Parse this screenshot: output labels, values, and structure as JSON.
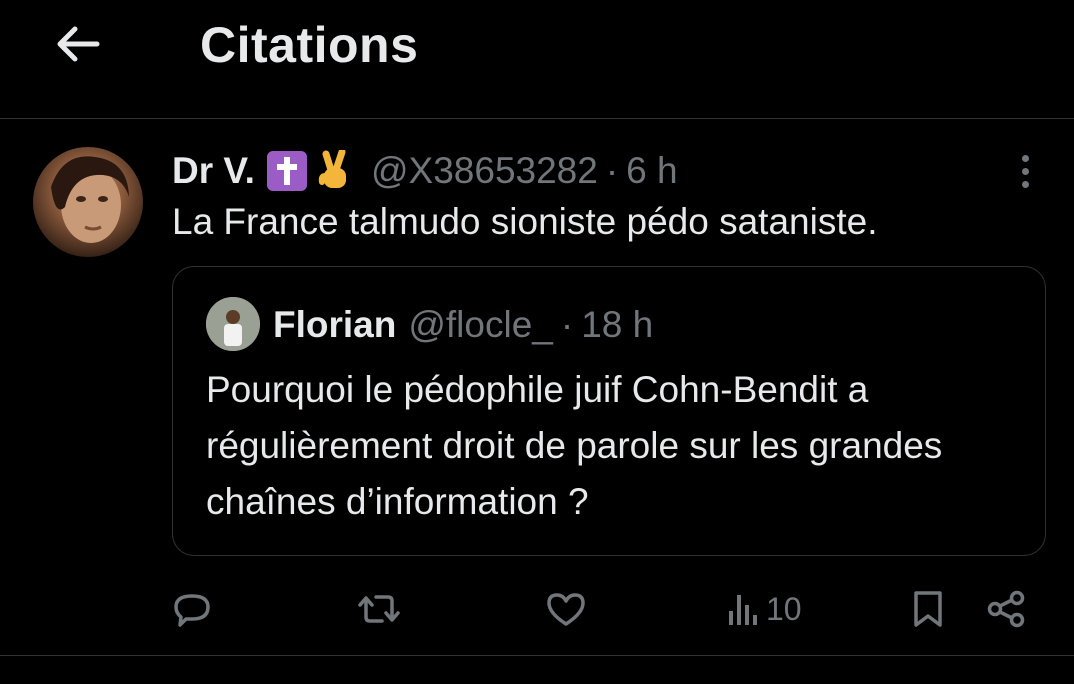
{
  "header": {
    "title": "Citations"
  },
  "tweet": {
    "author": {
      "display_name": "Dr V.",
      "handle": "@X38653282"
    },
    "separator": "·",
    "time": "6 h",
    "text": "La France talmudo sioniste pédo sataniste.",
    "quoted": {
      "author": {
        "display_name": "Florian",
        "handle": "@flocle_"
      },
      "separator": "·",
      "time": "18 h",
      "text": "Pourquoi le pédophile juif Cohn-Bendit a régulièrement droit de parole sur les grandes chaînes d’information ?"
    },
    "actions": {
      "views": "10"
    }
  },
  "colors": {
    "background": "#000000",
    "text_primary": "#e7e9ea",
    "text_secondary": "#71767b",
    "border": "#2f3336"
  },
  "icons": {
    "back": "arrow-left-icon",
    "more": "more-vertical-icon",
    "reply": "reply-icon",
    "repost": "repost-icon",
    "like": "heart-icon",
    "views": "views-icon",
    "bookmark": "bookmark-icon",
    "share": "share-icon"
  }
}
